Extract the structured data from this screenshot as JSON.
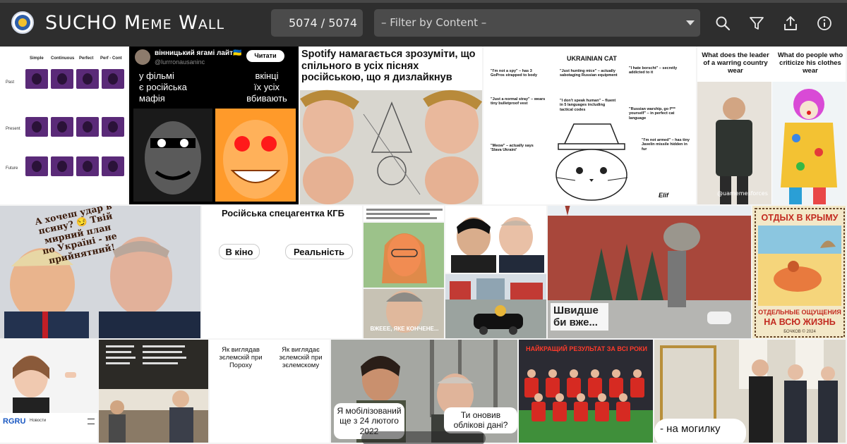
{
  "header": {
    "title": "SUCHO Meme Wall",
    "counter": "5074 / 5074",
    "filter_placeholder": "– Filter by Content –",
    "icons": [
      "search-icon",
      "filter-icon",
      "share-icon",
      "info-icon"
    ]
  },
  "tiles": {
    "grammar": {
      "col_headers": [
        "Simple",
        "Continuous",
        "Perfect",
        "Perf - Cont"
      ],
      "row_labels": [
        "Past",
        "Present",
        "Future"
      ]
    },
    "tweet": {
      "name": "вінницький ягамі лайт🇺🇦",
      "handle": "@lurrronausaninc",
      "button": "Читати",
      "line_left": "у фільмі\nє російська\nмафія",
      "line_right": "вкінці\nїх усіх\nвбивають"
    },
    "spotify": {
      "caption": "Spotify намагається зрозуміти, що спільного в усіх піснях російською, що я дизлайкнув"
    },
    "cat": {
      "title": "UKRAINIAN CAT",
      "quotes": [
        "\"I'm not a spy\" – has 3 GoPros strapped to body",
        "\"Just hunting mice\" – actually sabotaging Russian equipment",
        "\"I hate borscht\" – secretly addicted to it",
        "\"Just a normal stray\" – wears tiny bulletproof vest",
        "\"I don't speak human\" – fluent in 5 languages including tactical codes",
        "\"Russian warship, go f*** yourself\" – in perfect cat language",
        "\"Meow\" – actually says 'Slava Ukraini'",
        "\"I'm not armed\" – has tiny Javelin missile hidden in fur"
      ],
      "signature": "Elif"
    },
    "leader": {
      "left": "What does the leader of a warring country wear",
      "right": "What do people who criticize his clothes wear",
      "credit": "@uamemesforces"
    },
    "trump": {
      "caption": "А хочеш удар в псину? 😏 Твій мирний план по Україні - не прийнятний!"
    },
    "kgb": {
      "title": "Російська спецагентка КГБ",
      "left": "В кіно",
      "right": "Реальність"
    },
    "reader": {
      "caption": "ВЖЕЕЕ, ЯКЕ КОНЧЕНЕ..."
    },
    "square": {
      "caption": "Швидше би вже..."
    },
    "crimea": {
      "top": "ОТДЫХ В КРЫМУ",
      "bottom_a": "ОТДЕЛЬНЫЕ ОЩУЩЕНИЯ",
      "bottom_b": "НА ВСЮ ЖИЗНЬ",
      "signature": "БОЧКОВ © 2024"
    },
    "rgru": {
      "brand": "RGRU",
      "menu": "Новости"
    },
    "zelensky": {
      "left": "Як виглядав зєлемскій при Пороху",
      "right": "Як виглядає зєлемскій при зєлемскому"
    },
    "rambo": {
      "left": "Я мобілізований ще з 24 лютого 2022",
      "right": "Ти оновив облікові дані?"
    },
    "football": {
      "caption": "НАЙКРАЩИЙ РЕЗУЛЬТАТ ЗА ВСІ РОКИ"
    },
    "mirror": {
      "caption": "- на могилку"
    }
  },
  "colors": {
    "header_bg": "#2e2e2e",
    "control_bg": "#4b4b4b",
    "accent_red": "#d62a22",
    "pitch_green": "#3f8f3a"
  }
}
